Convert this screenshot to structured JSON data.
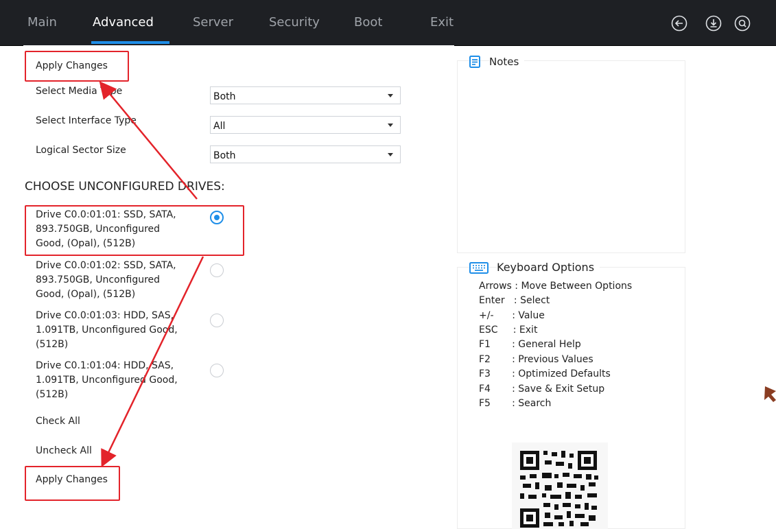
{
  "tabs": [
    {
      "label": "Main"
    },
    {
      "label": "Advanced"
    },
    {
      "label": "Server"
    },
    {
      "label": "Security"
    },
    {
      "label": "Boot"
    },
    {
      "label": "Exit"
    }
  ],
  "toolbar_icons": [
    "back-icon",
    "download-icon",
    "search-icon"
  ],
  "apply_top": "Apply Changes",
  "filters": [
    {
      "label": "Select Media Type",
      "value": "Both"
    },
    {
      "label": "Select Interface Type",
      "value": "All"
    },
    {
      "label": "Logical Sector Size",
      "value": "Both"
    }
  ],
  "drives_heading": "CHOOSE UNCONFIGURED DRIVES:",
  "drives": [
    {
      "lines": [
        "Drive C0.0:01:01: SSD, SATA,",
        "893.750GB, Unconfigured",
        "Good, (Opal), (512B)"
      ],
      "selected": true
    },
    {
      "lines": [
        "Drive C0.0:01:02: SSD, SATA,",
        "893.750GB, Unconfigured",
        "Good, (Opal), (512B)"
      ],
      "selected": false
    },
    {
      "lines": [
        "Drive C0.0:01:03: HDD, SAS,",
        "1.091TB, Unconfigured Good,",
        "(512B)"
      ],
      "selected": false
    },
    {
      "lines": [
        "Drive C0.1:01:04: HDD, SAS,",
        "1.091TB, Unconfigured Good,",
        "(512B)"
      ],
      "selected": false
    }
  ],
  "check_all": "Check All",
  "uncheck_all": "Uncheck All",
  "apply_bottom": "Apply Changes",
  "notes": {
    "title": "Notes"
  },
  "keyboard": {
    "title": "Keyboard Options",
    "rows": [
      "Arrows : Move Between Options",
      "Enter   : Select",
      "+/-      : Value",
      "ESC     : Exit",
      "F1       : General Help",
      "F2       : Previous Values",
      "F3       : Optimized Defaults",
      "F4       : Save & Exit Setup",
      "F5       : Search"
    ]
  },
  "colors": {
    "accent": "#1e8ee8",
    "annotation": "#e3232a",
    "topbar": "#1e2024"
  }
}
